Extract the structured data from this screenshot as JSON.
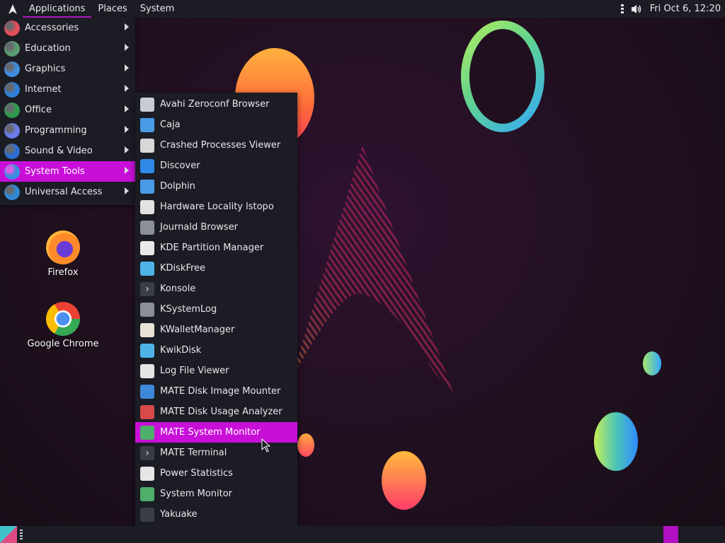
{
  "top_panel": {
    "applications": "Applications",
    "places": "Places",
    "system": "System",
    "clock": "Fri Oct  6, 12:20"
  },
  "apps_menu": [
    {
      "label": "Accessories",
      "icon": "accessories-icon",
      "color": "#e24e5a"
    },
    {
      "label": "Education",
      "icon": "education-icon",
      "color": "#5a9d6f"
    },
    {
      "label": "Graphics",
      "icon": "graphics-icon",
      "color": "#3f8fe0"
    },
    {
      "label": "Internet",
      "icon": "internet-icon",
      "color": "#2f7fd8"
    },
    {
      "label": "Office",
      "icon": "office-icon",
      "color": "#2f9a4f"
    },
    {
      "label": "Programming",
      "icon": "programming-icon",
      "color": "#6a7de8"
    },
    {
      "label": "Sound & Video",
      "icon": "sound-video-icon",
      "color": "#2d6fd0"
    },
    {
      "label": "System Tools",
      "icon": "system-tools-icon",
      "color": "#3a8fdc",
      "selected": true
    },
    {
      "label": "Universal Access",
      "icon": "universal-access-icon",
      "color": "#2f89d6"
    }
  ],
  "system_tools_submenu": [
    {
      "label": "Avahi Zeroconf Browser",
      "icon": "monitor-icon",
      "color": "#c9ccd3"
    },
    {
      "label": "Caja",
      "icon": "folder-icon",
      "color": "#4a9be6"
    },
    {
      "label": "Crashed Processes Viewer",
      "icon": "crash-icon",
      "color": "#d8d8d8"
    },
    {
      "label": "Discover",
      "icon": "discover-icon",
      "color": "#2e8ae6"
    },
    {
      "label": "Dolphin",
      "icon": "folder-icon",
      "color": "#4a9be6"
    },
    {
      "label": "Hardware Locality lstopo",
      "icon": "no-entry-icon",
      "color": "#e2e2e2"
    },
    {
      "label": "Journald Browser",
      "icon": "log-icon",
      "color": "#8c8f98"
    },
    {
      "label": "KDE Partition Manager",
      "icon": "partition-icon",
      "color": "#e9e9e9"
    },
    {
      "label": "KDiskFree",
      "icon": "kdiskfree-icon",
      "color": "#4fb3e8"
    },
    {
      "label": "Konsole",
      "icon": "terminal-icon",
      "color": "#3a3d45"
    },
    {
      "label": "KSystemLog",
      "icon": "log-icon",
      "color": "#8c8f98"
    },
    {
      "label": "KWalletManager",
      "icon": "wallet-icon",
      "color": "#e8e2d6"
    },
    {
      "label": "KwikDisk",
      "icon": "kwikdisk-icon",
      "color": "#4fb3e8"
    },
    {
      "label": "Log File Viewer",
      "icon": "magnifier-icon",
      "color": "#e6e6e6"
    },
    {
      "label": "MATE Disk Image Mounter",
      "icon": "disk-image-icon",
      "color": "#3d88d8"
    },
    {
      "label": "MATE Disk Usage Analyzer",
      "icon": "disk-usage-icon",
      "color": "#d84a4a"
    },
    {
      "label": "MATE System Monitor",
      "icon": "system-monitor-icon",
      "color": "#4fae6a",
      "selected": true
    },
    {
      "label": "MATE Terminal",
      "icon": "terminal-icon",
      "color": "#3a3d45"
    },
    {
      "label": "Power Statistics",
      "icon": "power-stats-icon",
      "color": "#e6e6e6"
    },
    {
      "label": "System Monitor",
      "icon": "system-monitor-icon",
      "color": "#4fae6a"
    },
    {
      "label": "Yakuake",
      "icon": "yakuake-icon",
      "color": "#3a3d45"
    }
  ],
  "desktop": {
    "firefox": "Firefox",
    "chrome": "Google Chrome"
  },
  "colors": {
    "accent": "#c80fd8",
    "panel": "#1c1d24",
    "menu_bg": "#1b1c24"
  }
}
